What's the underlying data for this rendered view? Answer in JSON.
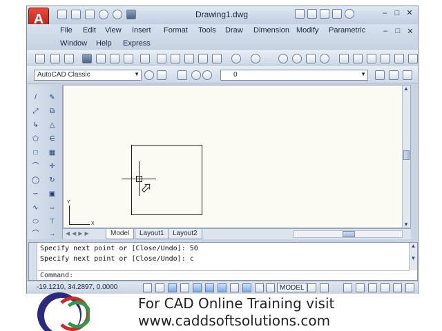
{
  "app": {
    "logo_letter": "A",
    "title": "Drawing1.dwg"
  },
  "menu": {
    "items": [
      "File",
      "Edit",
      "View",
      "Insert",
      "Format",
      "Tools",
      "Draw",
      "Dimension",
      "Modify",
      "Parametric",
      "Window",
      "Help",
      "Express"
    ]
  },
  "workspace": {
    "value": "AutoCAD Classic"
  },
  "layer": {
    "value": "0"
  },
  "tabs": [
    "Model",
    "Layout1",
    "Layout2"
  ],
  "ucs": {
    "x_label": "X",
    "y_label": "Y"
  },
  "command": {
    "history": [
      "Specify next point or [Close/Undo]: 50",
      "Specify next point or [Close/Undo]: c"
    ],
    "prompt": "Command:"
  },
  "status": {
    "coords": "-19.1210, 34.2897, 0.0000",
    "model_label": "MODEL"
  },
  "promo": {
    "line1": "For CAD Online Training visit",
    "line2": "www.caddsoftsolutions.com"
  },
  "colors": {
    "app_red": "#c0281c",
    "canvas_bg": "#fbfbf4",
    "logo_blue": "#2c2a7d",
    "logo_red": "#cf2a2a",
    "logo_green": "#2e9b46"
  }
}
